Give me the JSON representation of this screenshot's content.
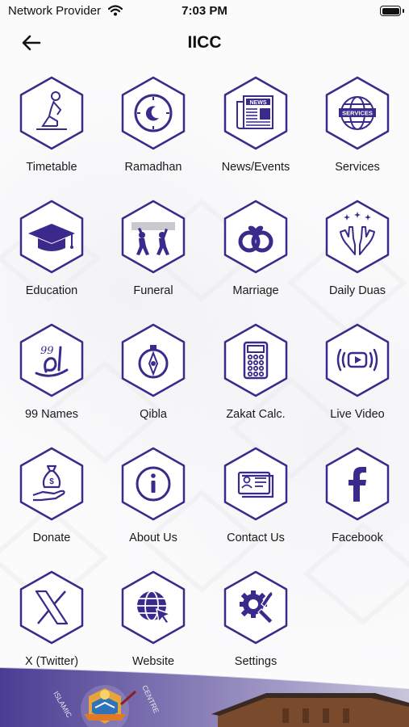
{
  "status": {
    "carrier": "Network Provider",
    "time": "7:03 PM"
  },
  "nav": {
    "title": "IICC"
  },
  "colors": {
    "accent": "#3b2a8c",
    "hexFill": "#ffffff"
  },
  "menu": [
    {
      "label": "Timetable",
      "icon": "praying-person-icon"
    },
    {
      "label": "Ramadhan",
      "icon": "crescent-clock-icon"
    },
    {
      "label": "News/Events",
      "icon": "newspaper-icon"
    },
    {
      "label": "Services",
      "icon": "globe-services-icon"
    },
    {
      "label": "Education",
      "icon": "graduation-cap-icon"
    },
    {
      "label": "Funeral",
      "icon": "coffin-bearers-icon"
    },
    {
      "label": "Marriage",
      "icon": "rings-icon"
    },
    {
      "label": "Daily Duas",
      "icon": "praying-hands-icon"
    },
    {
      "label": "99 Names",
      "icon": "calligraphy-icon"
    },
    {
      "label": "Qibla",
      "icon": "compass-icon"
    },
    {
      "label": "Zakat Calc.",
      "icon": "calculator-icon"
    },
    {
      "label": "Live Video",
      "icon": "live-play-icon"
    },
    {
      "label": "Donate",
      "icon": "money-bag-hand-icon"
    },
    {
      "label": "About Us",
      "icon": "info-icon"
    },
    {
      "label": "Contact Us",
      "icon": "contact-card-icon"
    },
    {
      "label": "Facebook",
      "icon": "facebook-icon"
    },
    {
      "label": "X (Twitter)",
      "icon": "x-logo-icon"
    },
    {
      "label": "Website",
      "icon": "web-cursor-icon"
    },
    {
      "label": "Settings",
      "icon": "gear-tools-icon"
    }
  ],
  "footer": {
    "logo_text_left": "ISLAMIC",
    "logo_text_right": "CENTRE"
  }
}
